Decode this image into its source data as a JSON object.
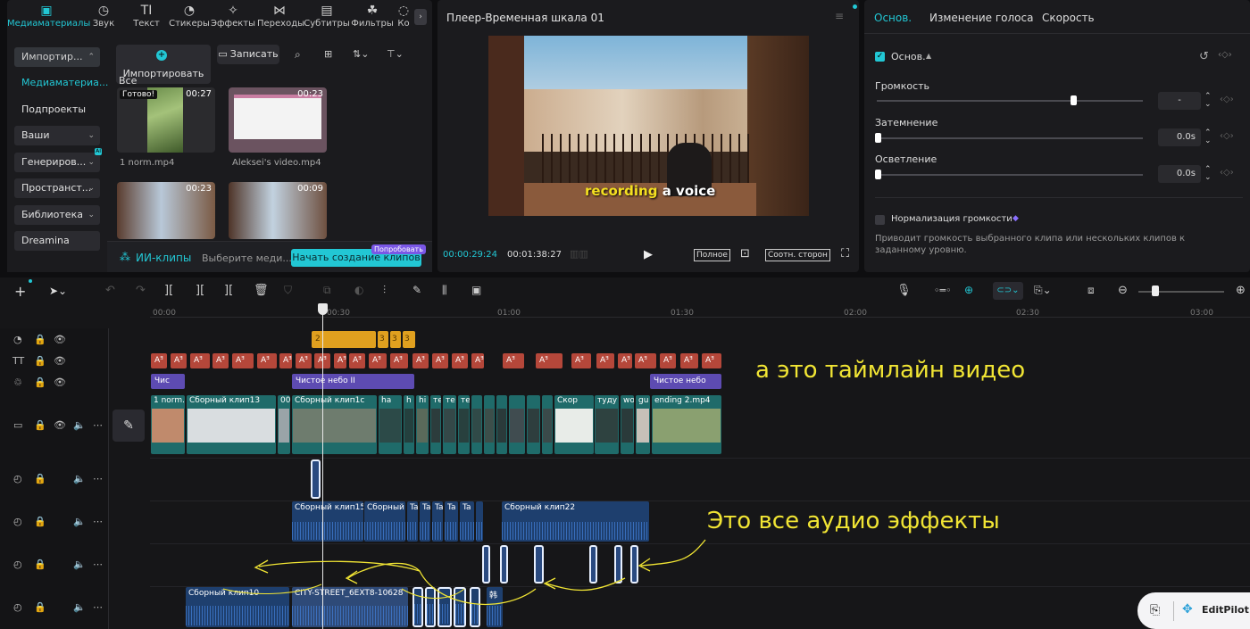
{
  "media_tabs": [
    {
      "label": "Медиаматериалы",
      "icon": "media-icon",
      "active": true
    },
    {
      "label": "Звук",
      "icon": "audio-icon"
    },
    {
      "label": "Текст",
      "icon": "text-icon"
    },
    {
      "label": "Стикеры",
      "icon": "sticker-icon"
    },
    {
      "label": "Эффекты",
      "icon": "effects-icon"
    },
    {
      "label": "Переходы",
      "icon": "transitions-icon"
    },
    {
      "label": "Субтитры",
      "icon": "subtitles-icon"
    },
    {
      "label": "Фильтры",
      "icon": "filters-icon"
    },
    {
      "label": "Ко",
      "icon": "more-icon"
    }
  ],
  "sidebar": {
    "items": [
      {
        "label": "Импортир...",
        "chevron": "⌃"
      },
      {
        "label": "Медиаматериа..."
      },
      {
        "label": "Подпроекты"
      },
      {
        "label": "Ваши",
        "chevron": "⌄"
      },
      {
        "label": "Генериров...",
        "chevron": "⌄",
        "badge": "AI"
      },
      {
        "label": "Пространст...",
        "chevron": "⌄"
      },
      {
        "label": "Библиотека",
        "chevron": "⌄"
      },
      {
        "label": "Dreamina"
      }
    ]
  },
  "media": {
    "import_label": "Импортировать",
    "record_label": "Записать",
    "section_label": "Все",
    "thumbs": [
      {
        "name": "1 norm.mp4",
        "duration": "00:27",
        "status": "Готово!"
      },
      {
        "name": "Aleksei's video.mp4",
        "duration": "00:23"
      },
      {
        "name": "",
        "duration": "00:23"
      },
      {
        "name": "",
        "duration": "00:09"
      }
    ],
    "ai_clips_label": "ИИ-клипы",
    "select_media_label": "Выберите меди...",
    "start_label": "Начать создание клипов",
    "try_badge": "Попробовать"
  },
  "player": {
    "title": "Плеер-Временная шкала 01",
    "caption_a": "recording",
    "caption_b": "a voice",
    "current_time": "00:00:29:24",
    "total_time": "00:01:38:27",
    "full_label": "Полное",
    "ratio_label": "Соотн. сторон"
  },
  "props": {
    "tabs": [
      "Основ.",
      "Изменение голоса",
      "Скорость"
    ],
    "basic_label": "Основ.",
    "volume_label": "Громкость",
    "volume_value": "-",
    "volume_level": 0.84,
    "fadein_label": "Затемнение",
    "fadein_value": "0.0s",
    "fadeout_label": "Осветление",
    "fadeout_value": "0.0s",
    "normalize_label": "Нормализация громкости",
    "normalize_desc": "Приводит громкость выбранного клипа или нескольких клипов к заданному уровню."
  },
  "ruler": [
    "00:00",
    "00:30",
    "01:00",
    "01:30",
    "02:00",
    "02:30",
    "03:00"
  ],
  "timeline": {
    "effects": [
      "Чис",
      "Чистое небо II",
      "Чистое небо"
    ],
    "video_clips": [
      "1 norm.",
      "Сборный клип13",
      "00",
      "Сборный клип1с",
      "ha",
      "h",
      "hi",
      "те",
      "те",
      "те",
      "",
      "",
      " ",
      "",
      "",
      " ",
      "Скор",
      "туду",
      "wo",
      "gu",
      "ending 2.mp4"
    ],
    "text_clip_label": "Aᴲ",
    "sticker_labels": [
      "2",
      "3",
      "3",
      "3"
    ],
    "audio_clips_row2": [
      "Сборный клип15",
      "Сборный",
      "Ta",
      "Ta",
      "Ta",
      "Ta",
      "Ta",
      "Сборный клип22"
    ],
    "audio_clips_row4": [
      "Сборный клип10",
      "CITY-STREET_6EXT8-10628",
      "",
      "",
      "",
      "",
      "",
      "韩"
    ]
  },
  "annotations": {
    "timeline_note": "а это таймлайн видео",
    "audio_note": "Это все аудио эффекты"
  },
  "editpilot": "EditPilot",
  "colors": {
    "accent": "#22c7d4",
    "text_clip": "#b5473a",
    "effect": "#5d4bb2",
    "video": "#1f6b6a",
    "audio": "#1e3f6e",
    "sticker": "#e0a01f",
    "annotation": "#f1e534"
  }
}
